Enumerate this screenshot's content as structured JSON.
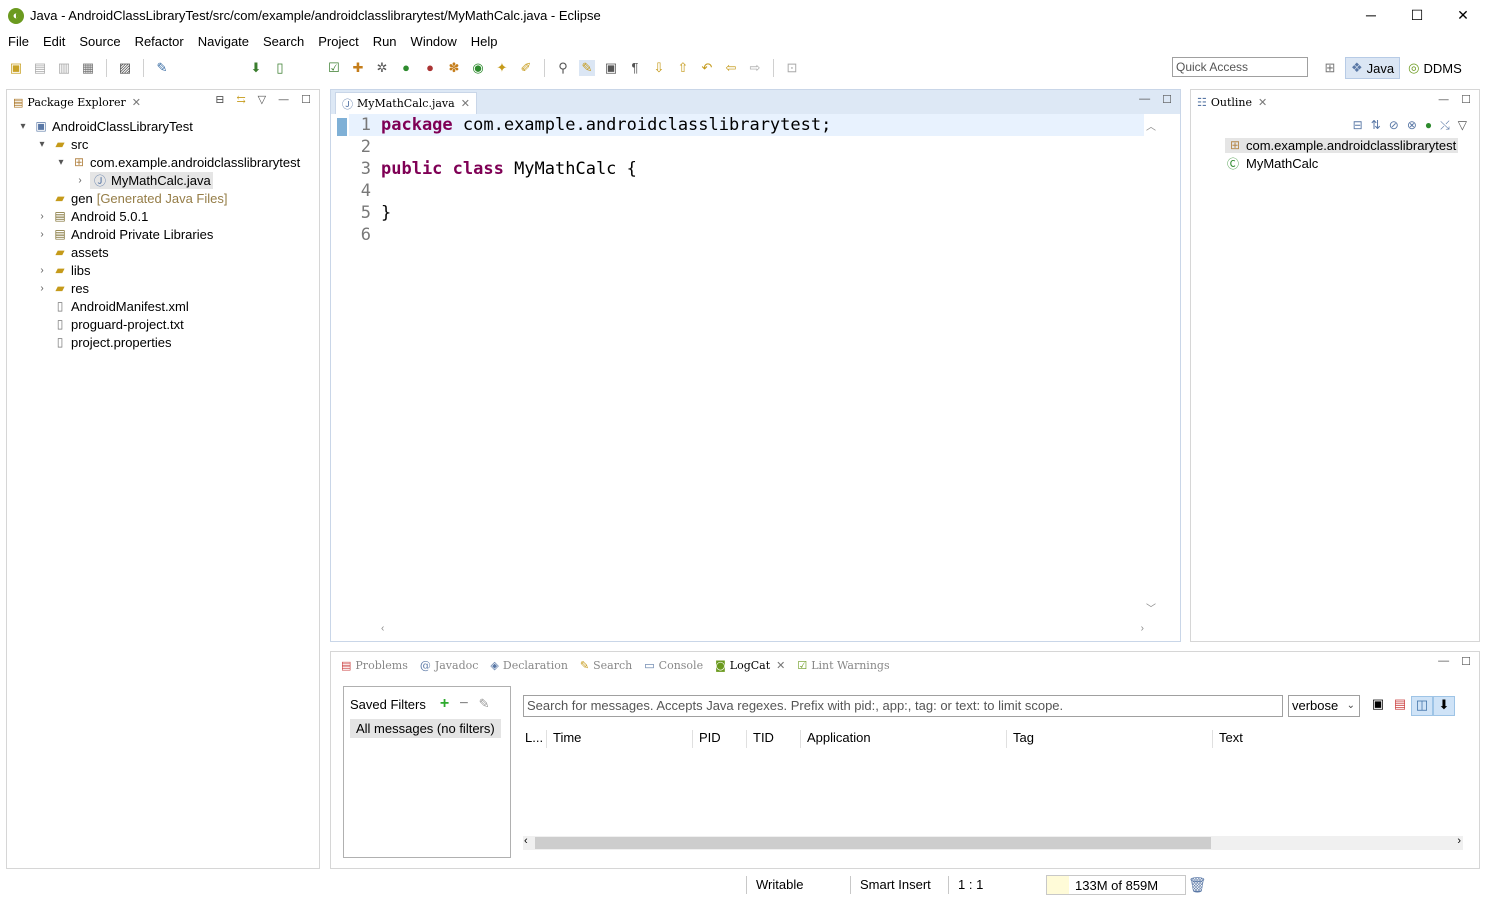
{
  "window": {
    "title": "Java - AndroidClassLibraryTest/src/com/example/androidclasslibrarytest/MyMathCalc.java - Eclipse",
    "minimize": "─",
    "maximize": "☐",
    "close": "✕"
  },
  "menu": [
    "File",
    "Edit",
    "Source",
    "Refactor",
    "Navigate",
    "Search",
    "Project",
    "Run",
    "Window",
    "Help"
  ],
  "toolbar": {
    "quick_access_placeholder": "Quick Access",
    "perspectives": [
      {
        "label": "Java",
        "active": true
      },
      {
        "label": "DDMS",
        "active": false
      }
    ]
  },
  "package_explorer": {
    "tab_label": "Package Explorer",
    "tree": [
      {
        "label": "AndroidClassLibraryTest",
        "arrow": "▾",
        "icon": "project-icon"
      },
      {
        "label": "src",
        "arrow": "▾",
        "icon": "source-folder-icon"
      },
      {
        "label": "com.example.androidclasslibrarytest",
        "arrow": "▾",
        "icon": "package-icon"
      },
      {
        "label": "MyMathCalc.java",
        "arrow": "›",
        "icon": "java-file-icon"
      },
      {
        "label": "gen",
        "decoration": "[Generated Java Files]",
        "icon": "folder-icon"
      },
      {
        "label": "Android 5.0.1",
        "arrow": "›",
        "icon": "library-icon"
      },
      {
        "label": "Android Private Libraries",
        "arrow": "›",
        "icon": "library-icon"
      },
      {
        "label": "assets",
        "icon": "folder-icon"
      },
      {
        "label": "libs",
        "arrow": "›",
        "icon": "folder-icon"
      },
      {
        "label": "res",
        "arrow": "›",
        "icon": "folder-icon"
      },
      {
        "label": "AndroidManifest.xml",
        "icon": "xml-file-icon"
      },
      {
        "label": "proguard-project.txt",
        "icon": "text-file-icon"
      },
      {
        "label": "project.properties",
        "icon": "text-file-icon"
      }
    ]
  },
  "editor": {
    "tab_label": "MyMathCalc.java",
    "lines": [
      {
        "num": "1",
        "kw": "package",
        "rest": " com.example.androidclasslibrarytest;"
      },
      {
        "num": "2",
        "kw": "",
        "rest": ""
      },
      {
        "num": "3",
        "kw": "public class",
        "rest": " MyMathCalc {"
      },
      {
        "num": "4",
        "kw": "",
        "rest": ""
      },
      {
        "num": "5",
        "kw": "",
        "rest": "}"
      },
      {
        "num": "6",
        "kw": "",
        "rest": ""
      }
    ]
  },
  "outline": {
    "tab_label": "Outline",
    "items": [
      {
        "label": "com.example.androidclasslibrarytest",
        "icon": "package-icon"
      },
      {
        "label": "MyMathCalc",
        "icon": "class-icon"
      }
    ]
  },
  "bottom_panel": {
    "tabs": [
      {
        "label": "Problems",
        "icon": "problems-icon"
      },
      {
        "label": "Javadoc",
        "icon": "javadoc-icon"
      },
      {
        "label": "Declaration",
        "icon": "declaration-icon"
      },
      {
        "label": "Search",
        "icon": "search-icon"
      },
      {
        "label": "Console",
        "icon": "console-icon"
      },
      {
        "label": "LogCat",
        "icon": "logcat-icon",
        "active": true
      },
      {
        "label": "Lint Warnings",
        "icon": "lint-icon"
      }
    ],
    "saved_filters_title": "Saved Filters",
    "saved_filters_items": [
      "All messages (no filters)"
    ],
    "search_placeholder": "Search for messages. Accepts Java regexes. Prefix with pid:, app:, tag: or text: to limit scope.",
    "level": "verbose",
    "columns": [
      "L...",
      "Time",
      "PID",
      "TID",
      "Application",
      "Tag",
      "Text"
    ]
  },
  "status": {
    "writable": "Writable",
    "insert_mode": "Smart Insert",
    "position": "1 : 1",
    "heap": "133M of 859M"
  }
}
